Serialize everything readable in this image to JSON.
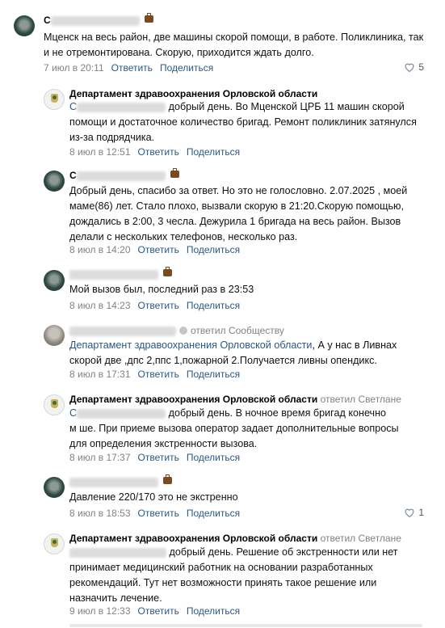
{
  "comments": [
    {
      "author": "С",
      "text": "Мценск на весь район, две машины скорой помощи, в работе. Поликлиника, так и не отремонтирована. Скорую, приходится ждать долго.",
      "date": "7 июл в 20:11",
      "reply": "Ответить",
      "share": "Поделиться",
      "likes": "5"
    },
    {
      "author": "Департамент здравоохранения Орловской области",
      "text_prefix": "С",
      "text": "добрый день. Во Мценской ЦРБ 11 машин скорой помощи и достаточное количество бригад. Ремонт поликлиник затянулся из-за подрядчика.",
      "date": "8 июл в 12:51",
      "reply": "Ответить",
      "share": "Поделиться"
    },
    {
      "author": "С",
      "text": "Добрый день, спасибо за ответ. Но это не голословно. 2.07.2025 , моей маме(86) лет. Стало плохо, вызвали скорую в 21:20.Скорую помощью, дождались в 2:00, 3 чесла. Дежурила 1 бригада на весь район. Вызов делали с нескольких телефонов, несколько раз.",
      "date": "8 июл в 14:20",
      "reply": "Ответить",
      "share": "Поделиться"
    },
    {
      "text": "Мой вызов был, последний раз в 23:53",
      "date": "8 июл в 14:23",
      "reply": "Ответить",
      "share": "Поделиться"
    },
    {
      "replied": "ответил Сообществу",
      "text_link": "Департамент здравоохранения Орловской области",
      "text": ", А у нас в Ливнах скорой две ,дпс 2,ппс 1,пожарной 2.Получается ливны опендикс.",
      "date": "8 июл в 17:31",
      "reply": "Ответить",
      "share": "Поделиться"
    },
    {
      "author": "Департамент здравоохранения Орловской области",
      "replied": "ответил Светлане",
      "text_prefix": "С",
      "text_line1": "добрый день. В ночное время бригад конечно",
      "text_line2": "м        ше. При приеме вызова оператор задает дополнительные вопросы для определения экстренности вызова.",
      "date": "8 июл в 17:37",
      "reply": "Ответить",
      "share": "Поделиться"
    },
    {
      "text": "Давление 220/170 это не экстренно",
      "date": "8 июл в 18:53",
      "reply": "Ответить",
      "share": "Поделиться",
      "likes": "1"
    },
    {
      "author": "Департамент здравоохранения Орловской области",
      "replied": "ответил Светлане",
      "text": "добрый день. Решение об экстренности или нет принимает медицинский работник на основании разработанных рекомендаций. Тут нет возможности принять такое решение или назначить лечение.",
      "date": "9 июл в 12:33",
      "reply": "Ответить",
      "share": "Поделиться"
    }
  ]
}
